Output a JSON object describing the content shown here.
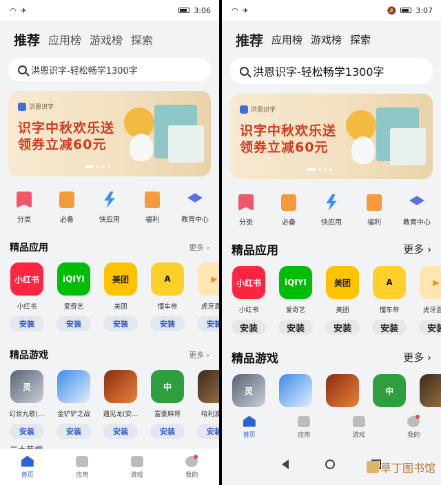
{
  "status": {
    "left_time": "3:06",
    "right_time": "3:07",
    "wifi_icon": "wifi-icon",
    "airplane_icon": "airplane-icon"
  },
  "tabs": [
    "推荐",
    "应用榜",
    "游戏榜",
    "探索"
  ],
  "search": {
    "value": "洪恩识字-轻松畅学1300字"
  },
  "banner": {
    "brand": "洪恩识字",
    "line1": "识字中秋欢乐送",
    "line2": "领券立减60元"
  },
  "quick": [
    "分类",
    "必备",
    "快应用",
    "福利",
    "教育中心"
  ],
  "apps_section": {
    "title": "精品应用",
    "more": "更多 ›"
  },
  "apps": [
    {
      "name": "小红书",
      "icon_text": "小红书"
    },
    {
      "name": "爱奇艺",
      "icon_text": "iQIYI"
    },
    {
      "name": "美团",
      "icon_text": "美团"
    },
    {
      "name": "懂车帝",
      "icon_text": "A"
    },
    {
      "name": "虎牙直播",
      "icon_text": "▶"
    }
  ],
  "install_label": "安装",
  "games_section": {
    "title": "精品游戏",
    "more": "更多 ›"
  },
  "games": [
    {
      "name": "幻世九歌(…",
      "icon_text": "灵"
    },
    {
      "name": "金铲铲之战",
      "icon_text": ""
    },
    {
      "name": "遇见龙(安…",
      "icon_text": ""
    },
    {
      "name": "富豪麻将",
      "icon_text": "中"
    },
    {
      "name": "哈利波特",
      "icon_text": ""
    }
  ],
  "partial_row_text": "二大节炯",
  "bottom_nav": [
    "首页",
    "应用",
    "游戏",
    "我的"
  ],
  "watermark": "草丁图书馆",
  "colors": {
    "accent": "#2a63d6",
    "banner_red": "#d2391c",
    "install_text": "#2a56c6"
  }
}
